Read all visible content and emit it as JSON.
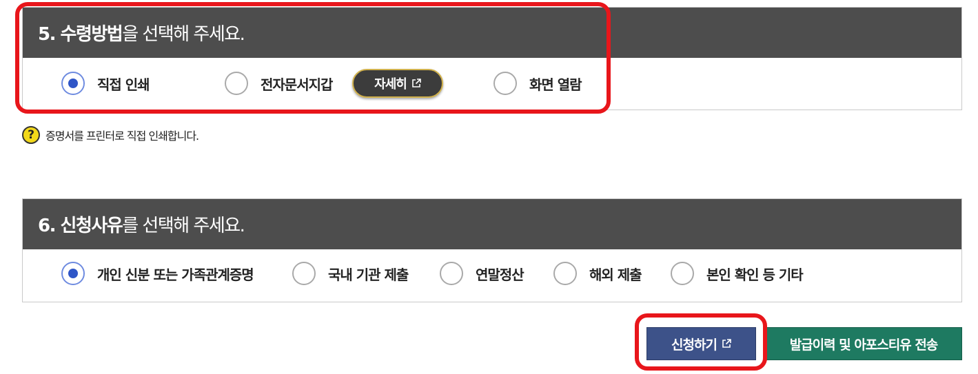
{
  "section5": {
    "title_bold": "5. 수령방법",
    "title_rest": "을 선택해 주세요.",
    "options": [
      {
        "label": "직접 인쇄",
        "checked": true
      },
      {
        "label": "전자문서지갑",
        "checked": false
      },
      {
        "label": "화면 열람",
        "checked": false
      }
    ],
    "detail_button": "자세히",
    "hint": "증명서를 프린터로 직접 인쇄합니다.",
    "hint_icon": "?"
  },
  "section6": {
    "title_bold": "6. 신청사유",
    "title_rest": "를 선택해 주세요.",
    "options": [
      {
        "label": "개인 신분 또는 가족관계증명",
        "checked": true
      },
      {
        "label": "국내 기관 제출",
        "checked": false
      },
      {
        "label": "연말정산",
        "checked": false
      },
      {
        "label": "해외 제출",
        "checked": false
      },
      {
        "label": "본인 확인 등 기타",
        "checked": false
      }
    ]
  },
  "buttons": {
    "apply": "신청하기",
    "history": "발급이력 및 아포스티유 전송"
  },
  "colors": {
    "header_bg": "#4d4d4d",
    "radio_selected": "#2f56c7",
    "apply_btn": "#3d5289",
    "history_btn": "#1e7a61",
    "highlight": "#e8161b"
  }
}
